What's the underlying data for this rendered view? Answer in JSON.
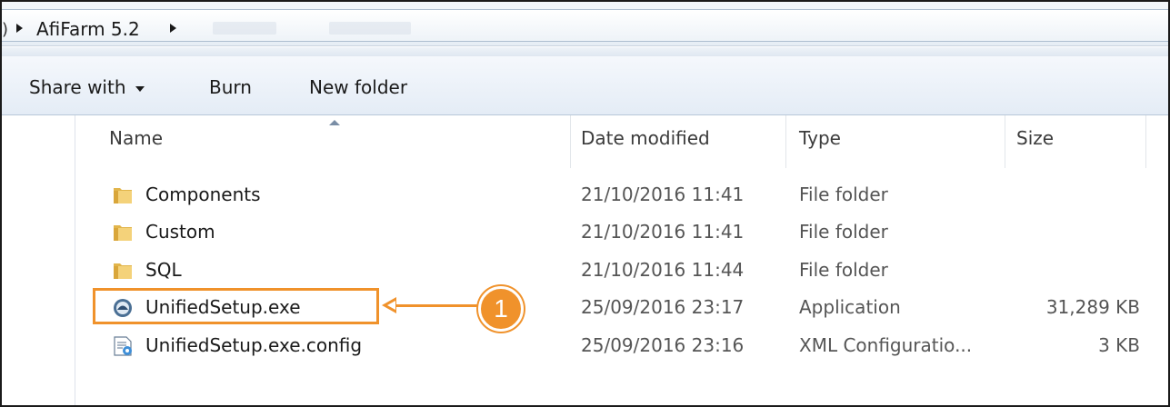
{
  "address_bar": {
    "path_label": "AfiFarm 5.2"
  },
  "toolbar": {
    "share_label": "Share with",
    "burn_label": "Burn",
    "new_folder_label": "New folder"
  },
  "columns": {
    "name": "Name",
    "date": "Date modified",
    "type": "Type",
    "size": "Size"
  },
  "files": [
    {
      "name": "Components",
      "date": "21/10/2016 11:41",
      "type": "File folder",
      "size": "",
      "icon": "folder-icon"
    },
    {
      "name": "Custom",
      "date": "21/10/2016 11:41",
      "type": "File folder",
      "size": "",
      "icon": "folder-icon"
    },
    {
      "name": "SQL",
      "date": "21/10/2016 11:44",
      "type": "File folder",
      "size": "",
      "icon": "folder-icon"
    },
    {
      "name": "UnifiedSetup.exe",
      "date": "25/09/2016 23:17",
      "type": "Application",
      "size": "31,289 KB",
      "icon": "application-icon"
    },
    {
      "name": "UnifiedSetup.exe.config",
      "date": "25/09/2016 23:16",
      "type": "XML Configuratio...",
      "size": "3 KB",
      "icon": "config-file-icon"
    }
  ],
  "callout": {
    "number": "1",
    "color": "#f0922b"
  }
}
